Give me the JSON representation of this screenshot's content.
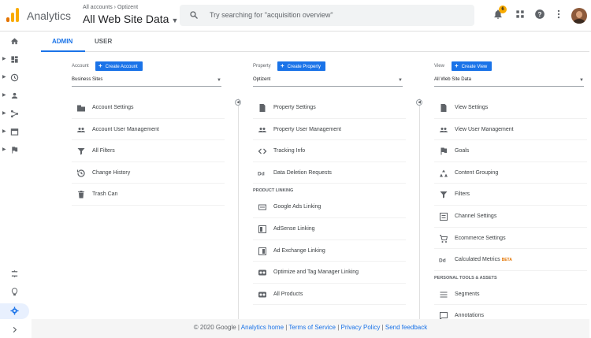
{
  "header": {
    "app_name": "Analytics",
    "breadcrumb": "All accounts › Optizent",
    "view_name": "All Web Site Data",
    "search_placeholder": "Try searching for \"acquisition overview\"",
    "notification_count": "6"
  },
  "tabs": [
    {
      "label": "ADMIN",
      "active": true
    },
    {
      "label": "USER",
      "active": false
    }
  ],
  "account": {
    "label": "Account",
    "create_label": "Create Account",
    "selected": "Business Sites",
    "items": [
      {
        "label": "Account Settings",
        "icon": "building-icon"
      },
      {
        "label": "Account User Management",
        "icon": "users-icon"
      },
      {
        "label": "All Filters",
        "icon": "filter-icon"
      },
      {
        "label": "Change History",
        "icon": "history-icon"
      },
      {
        "label": "Trash Can",
        "icon": "trash-icon"
      }
    ]
  },
  "property": {
    "label": "Property",
    "create_label": "Create Property",
    "selected": "Optizent",
    "items": [
      {
        "label": "Property Settings",
        "icon": "doc-icon"
      },
      {
        "label": "Property User Management",
        "icon": "users-icon"
      },
      {
        "label": "Tracking Info",
        "icon": "code-icon"
      },
      {
        "label": "Data Deletion Requests",
        "icon": "dd-icon"
      }
    ],
    "section_label": "PRODUCT LINKING",
    "linking_items": [
      {
        "label": "Google Ads Linking",
        "icon": "ads-icon"
      },
      {
        "label": "AdSense Linking",
        "icon": "adsense-icon"
      },
      {
        "label": "Ad Exchange Linking",
        "icon": "adexchange-icon"
      },
      {
        "label": "Optimize and Tag Manager Linking",
        "icon": "optimize-icon"
      },
      {
        "label": "All Products",
        "icon": "products-icon"
      }
    ]
  },
  "view": {
    "label": "View",
    "create_label": "Create View",
    "selected": "All Web Site Data",
    "items": [
      {
        "label": "View Settings",
        "icon": "doc-icon"
      },
      {
        "label": "View User Management",
        "icon": "users-icon"
      },
      {
        "label": "Goals",
        "icon": "flag-icon"
      },
      {
        "label": "Content Grouping",
        "icon": "grouping-icon"
      },
      {
        "label": "Filters",
        "icon": "filter-icon"
      },
      {
        "label": "Channel Settings",
        "icon": "channel-icon"
      },
      {
        "label": "Ecommerce Settings",
        "icon": "cart-icon"
      },
      {
        "label": "Calculated Metrics",
        "icon": "dd-icon",
        "badge": "BETA"
      }
    ],
    "section_label": "PERSONAL TOOLS & ASSETS",
    "tools_items": [
      {
        "label": "Segments",
        "icon": "segments-icon"
      },
      {
        "label": "Annotations",
        "icon": "annotations-icon"
      }
    ]
  },
  "footer": {
    "copyright": "© 2020 Google",
    "links": [
      "Analytics home",
      "Terms of Service",
      "Privacy Policy",
      "Send feedback"
    ]
  },
  "colors": {
    "accent": "#1a73e8",
    "logo_orange": "#f9ab00",
    "logo_dark": "#e37400"
  }
}
